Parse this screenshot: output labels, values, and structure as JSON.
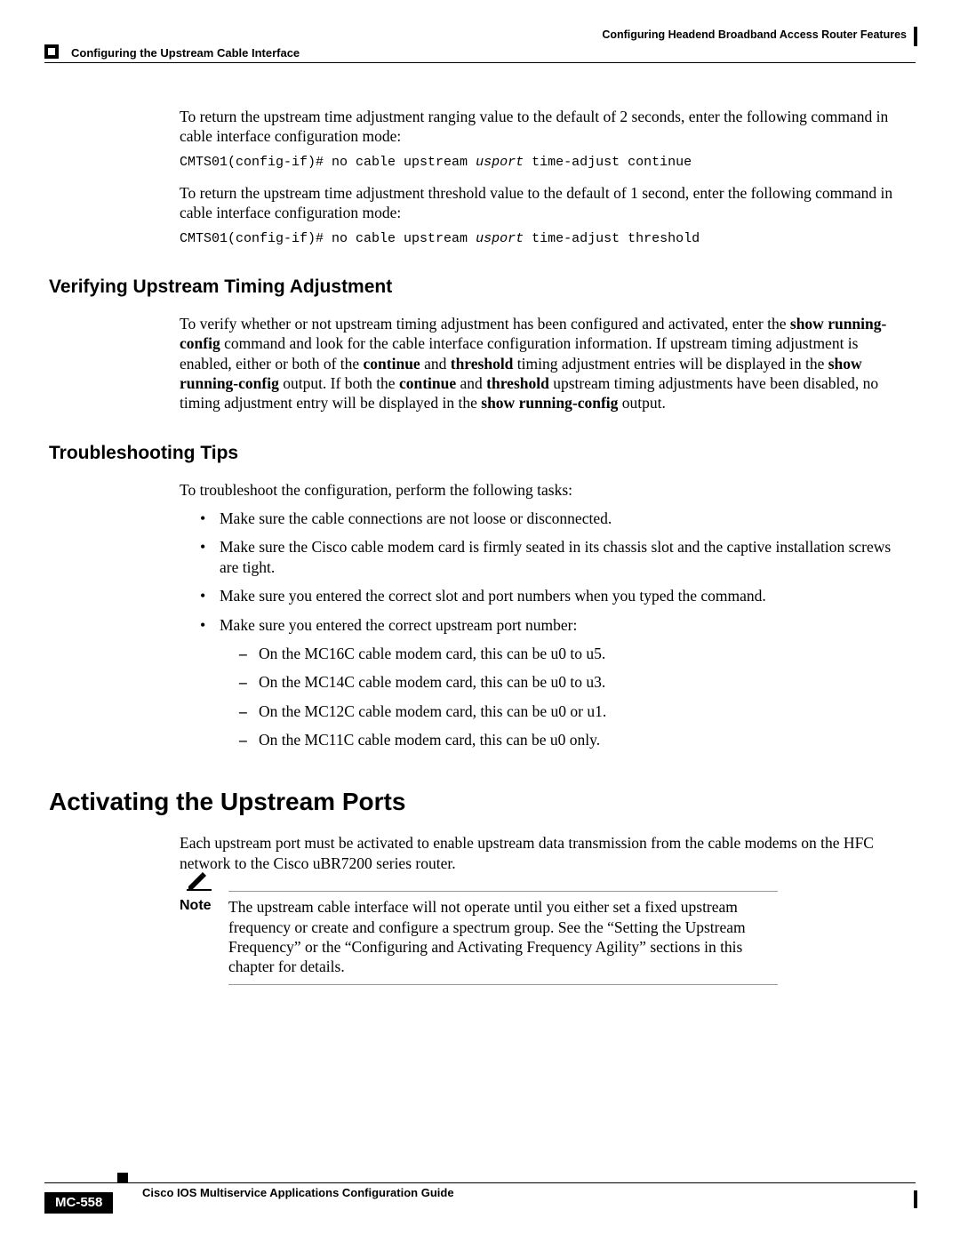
{
  "header": {
    "chapter_title": "Configuring Headend Broadband Access Router Features",
    "section_title": "Configuring the Upstream Cable Interface"
  },
  "body": {
    "para1": "To return the upstream time adjustment ranging value to the default of 2 seconds, enter the following command in cable interface configuration mode:",
    "cmd1_prefix": "CMTS01(config-if)# no cable upstream ",
    "cmd1_arg": "usport",
    "cmd1_suffix": " time-adjust continue",
    "para2": "To return the upstream time adjustment threshold value to the default of 1 second, enter the following command in cable interface configuration mode:",
    "cmd2_prefix": "CMTS01(config-if)# no cable upstream ",
    "cmd2_arg": "usport",
    "cmd2_suffix": " time-adjust threshold",
    "h2a": "Verifying Upstream Timing Adjustment",
    "verify_para_html": "To verify whether or not upstream timing adjustment has been configured and activated, enter the <b>show running-config</b> command and look for the cable interface configuration information. If upstream timing adjustment is enabled, either or both of the <b>continue</b> and <b>threshold</b> timing adjustment entries will be displayed in the <b>show running-config</b> output. If both the <b>continue</b> and <b>threshold</b> upstream timing adjustments have been disabled, no timing adjustment entry will be displayed in the <b>show&nbsp;running-config</b> output.",
    "h2b": "Troubleshooting Tips",
    "troubleshoot_intro": "To troubleshoot the configuration, perform the following tasks:",
    "bullets": [
      "Make sure the cable connections are not loose or disconnected.",
      "Make sure the Cisco cable modem card is firmly seated in its chassis slot and the captive installation screws are tight.",
      "Make sure you entered the correct slot and port numbers when you typed the command.",
      "Make sure you entered the correct upstream port number:"
    ],
    "subbullets": [
      "On the MC16C cable modem card, this can be u0 to u5.",
      "On the MC14C cable modem card, this can be u0 to u3.",
      "On the MC12C cable modem card, this can be u0 or u1.",
      "On the MC11C cable modem card, this can be u0 only."
    ],
    "h1": "Activating the Upstream Ports",
    "activate_para": "Each upstream port must be activated to enable upstream data transmission from the cable modems on the HFC network to the Cisco uBR7200 series router.",
    "note_label": "Note",
    "note_body": "The upstream cable interface will not operate until you either set a fixed upstream frequency or create and configure a spectrum group. See the “Setting the Upstream Frequency” or the “Configuring and Activating Frequency Agility” sections in this chapter for details."
  },
  "footer": {
    "book_title": "Cisco IOS Multiservice Applications Configuration Guide",
    "page_number": "MC-558"
  }
}
